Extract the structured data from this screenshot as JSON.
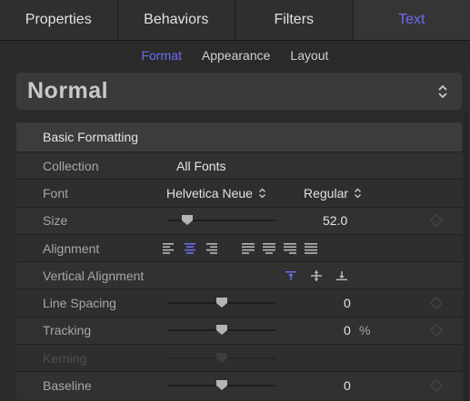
{
  "tabs": [
    {
      "label": "Properties",
      "active": false
    },
    {
      "label": "Behaviors",
      "active": false
    },
    {
      "label": "Filters",
      "active": false
    },
    {
      "label": "Text",
      "active": true
    }
  ],
  "subtabs": [
    {
      "label": "Format",
      "active": true
    },
    {
      "label": "Appearance",
      "active": false
    },
    {
      "label": "Layout",
      "active": false
    }
  ],
  "preset": {
    "label": "Normal",
    "icon": "up-down-chevron-icon"
  },
  "section": {
    "title": "Basic Formatting"
  },
  "rows": {
    "collection": {
      "label": "Collection",
      "value": "All Fonts"
    },
    "font": {
      "label": "Font",
      "family": "Helvetica Neue",
      "style": "Regular"
    },
    "size": {
      "label": "Size",
      "value": "52.0",
      "slider_fraction": 0.18
    },
    "alignment": {
      "label": "Alignment",
      "icons": [
        "align-left-icon",
        "align-center-icon",
        "align-right-icon",
        "justify-left-icon",
        "justify-center-icon",
        "justify-right-icon",
        "justify-full-icon"
      ],
      "selected": "align-center-icon"
    },
    "vertical_alignment": {
      "label": "Vertical Alignment",
      "icons": [
        "align-top-icon",
        "align-middle-icon",
        "align-bottom-icon"
      ],
      "selected": "align-top-icon"
    },
    "line_spacing": {
      "label": "Line Spacing",
      "value": "0",
      "slider_fraction": 0.5
    },
    "tracking": {
      "label": "Tracking",
      "value": "0",
      "unit": "%",
      "slider_fraction": 0.5
    },
    "kerning": {
      "label": "Kerning",
      "disabled": true,
      "slider_fraction": 0.5
    },
    "baseline": {
      "label": "Baseline",
      "value": "0",
      "slider_fraction": 0.5
    }
  },
  "colors": {
    "accent": "#6c6cf5",
    "panel": "#2b2b2b",
    "row_alt": "#313131"
  }
}
